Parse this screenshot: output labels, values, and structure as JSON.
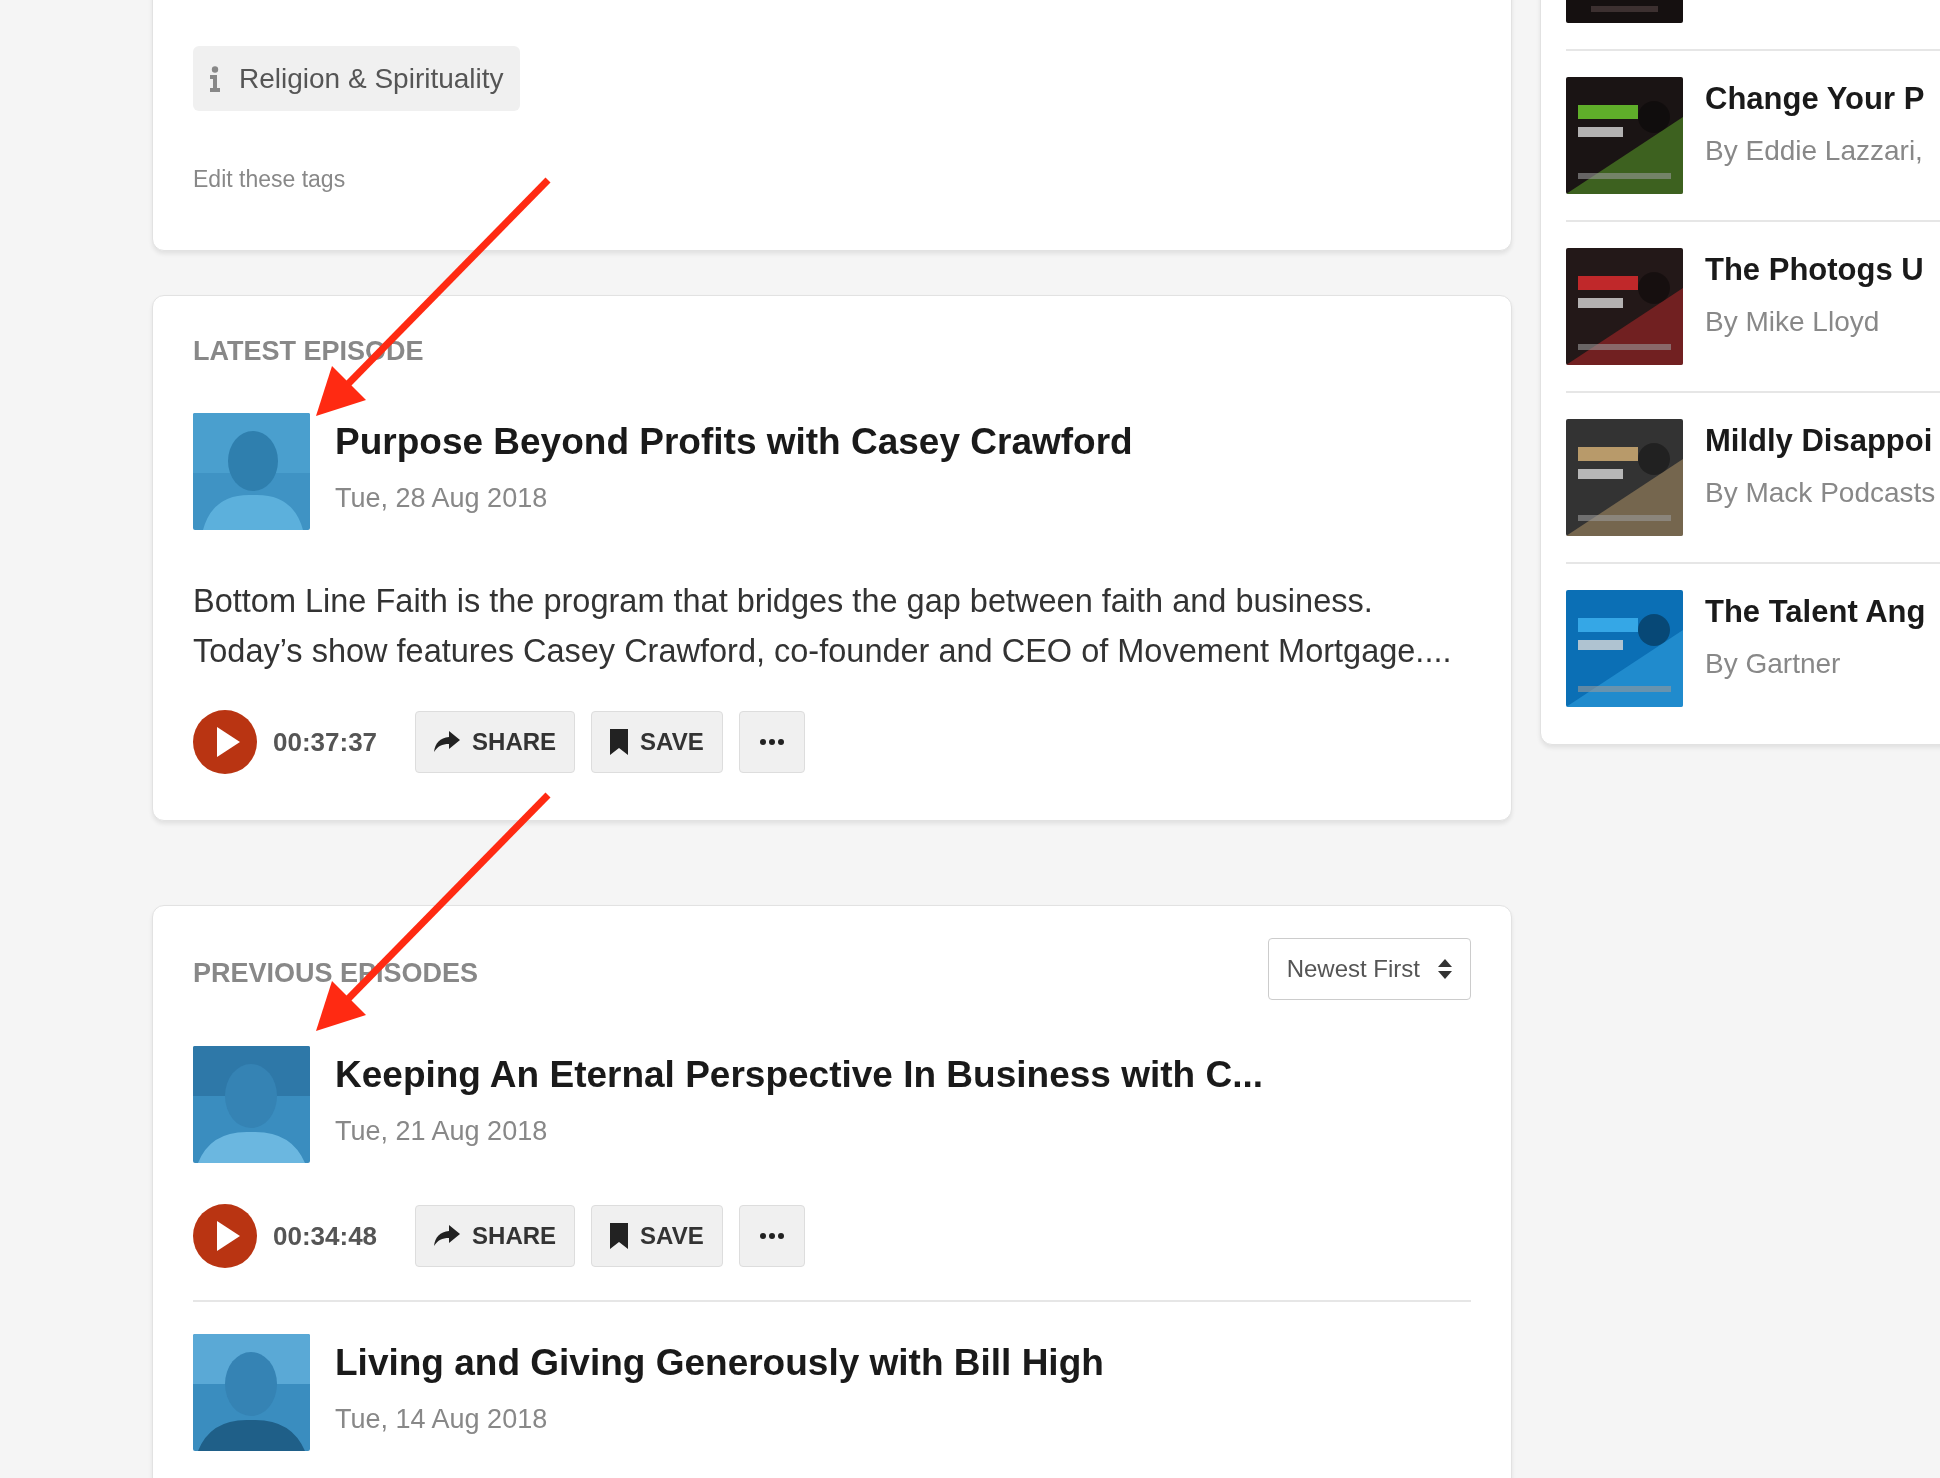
{
  "tags": {
    "items": [
      {
        "label": "Religion & Spirituality"
      }
    ],
    "edit_link": "Edit these tags"
  },
  "latest": {
    "heading": "LATEST EPISODE",
    "episode": {
      "title": "Purpose Beyond Profits with Casey Crawford",
      "date": "Tue, 28 Aug 2018",
      "description": "Bottom Line Faith is the program that bridges the gap between faith and business. Today’s show features Casey Crawford, co-founder and CEO of Movement Mortgage....",
      "duration": "00:37:37",
      "actions": [
        "SHARE",
        "SAVE"
      ]
    }
  },
  "previous": {
    "heading": "PREVIOUS EPISODES",
    "sort": {
      "value": "Newest First"
    },
    "episodes": [
      {
        "title": "Keeping An Eternal Perspective In Business with C...",
        "date": "Tue, 21 Aug 2018",
        "duration": "00:34:48",
        "actions": [
          "SHARE",
          "SAVE"
        ]
      },
      {
        "title": "Living and Giving Generously with Bill High",
        "date": "Tue, 14 Aug 2018"
      }
    ]
  },
  "related": {
    "items": [
      {
        "title": "Change Your P",
        "byline": "By Eddie Lazzari,"
      },
      {
        "title": "The Photogs U",
        "byline": "By Mike Lloyd"
      },
      {
        "title": "Mildly Disappoi",
        "byline": "By Mack Podcasts"
      },
      {
        "title": "The Talent Ang",
        "byline": "By Gartner"
      }
    ]
  }
}
